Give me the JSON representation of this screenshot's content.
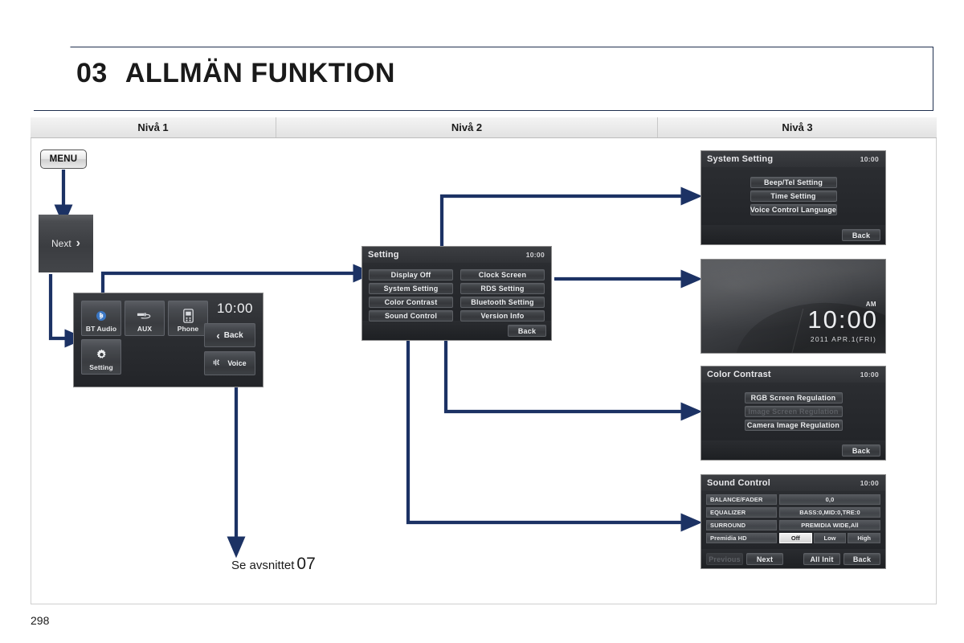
{
  "page": {
    "chapter_number": "03",
    "chapter_title": "ALLMÄN FUNKTION",
    "page_number": "298",
    "reference_caption": "Se avsnittet",
    "reference_number": "07",
    "accent_color": "#1c3264"
  },
  "levels": [
    {
      "label": "Nivå 1"
    },
    {
      "label": "Nivå 2"
    },
    {
      "label": "Nivå 3"
    }
  ],
  "hard_button": {
    "label": "MENU"
  },
  "next_tile": {
    "label": "Next",
    "chevron": "chevron-right-icon"
  },
  "main_screen": {
    "clock": "10:00",
    "tiles": [
      {
        "label": "BT Audio",
        "icon": "bluetooth-icon"
      },
      {
        "label": "AUX",
        "icon": "aux-plug-icon"
      },
      {
        "label": "Phone",
        "icon": "phone-icon"
      },
      {
        "label": "Setting",
        "icon": "gear-icon"
      }
    ],
    "back_label": "Back",
    "voice_label": "Voice"
  },
  "setting_screen": {
    "title": "Setting",
    "clock": "10:00",
    "items": [
      "Display Off",
      "Clock Screen",
      "System Setting",
      "RDS Setting",
      "Color Contrast",
      "Bluetooth Setting",
      "Sound Control",
      "Version Info"
    ],
    "back_label": "Back"
  },
  "system_setting_screen": {
    "title": "System Setting",
    "clock": "10:00",
    "items": [
      {
        "label": "Beep/Tel  Setting",
        "disabled": false
      },
      {
        "label": "Time  Setting",
        "disabled": false
      },
      {
        "label": "Voice Control Language",
        "disabled": false
      }
    ],
    "back_label": "Back"
  },
  "clock_screen": {
    "ampm": "AM",
    "time": "10:00",
    "date": "2011 APR.1(FRI)"
  },
  "color_contrast_screen": {
    "title": "Color Contrast",
    "clock": "10:00",
    "items": [
      {
        "label": "RGB  Screen  Regulation",
        "disabled": false
      },
      {
        "label": "Image  Screen  Regulation",
        "disabled": true
      },
      {
        "label": "Camera  Image  Regulation",
        "disabled": false
      }
    ],
    "back_label": "Back"
  },
  "sound_control_screen": {
    "title": "Sound Control",
    "clock": "10:00",
    "rows": [
      {
        "label": "BALANCE/FADER",
        "value": "0,0"
      },
      {
        "label": "EQUALIZER",
        "value": "BASS:0,MID:0,TRE:0"
      },
      {
        "label": "SURROUND",
        "value": "PREMIDIA  WIDE,All"
      }
    ],
    "segmented_row": {
      "label": "Premidia HD",
      "options": [
        "Off",
        "Low",
        "High"
      ],
      "selected": "Off"
    },
    "footer": {
      "previous_label": "Previous",
      "previous_disabled": true,
      "next_label": "Next",
      "all_init_label": "All Init",
      "back_label": "Back"
    }
  }
}
